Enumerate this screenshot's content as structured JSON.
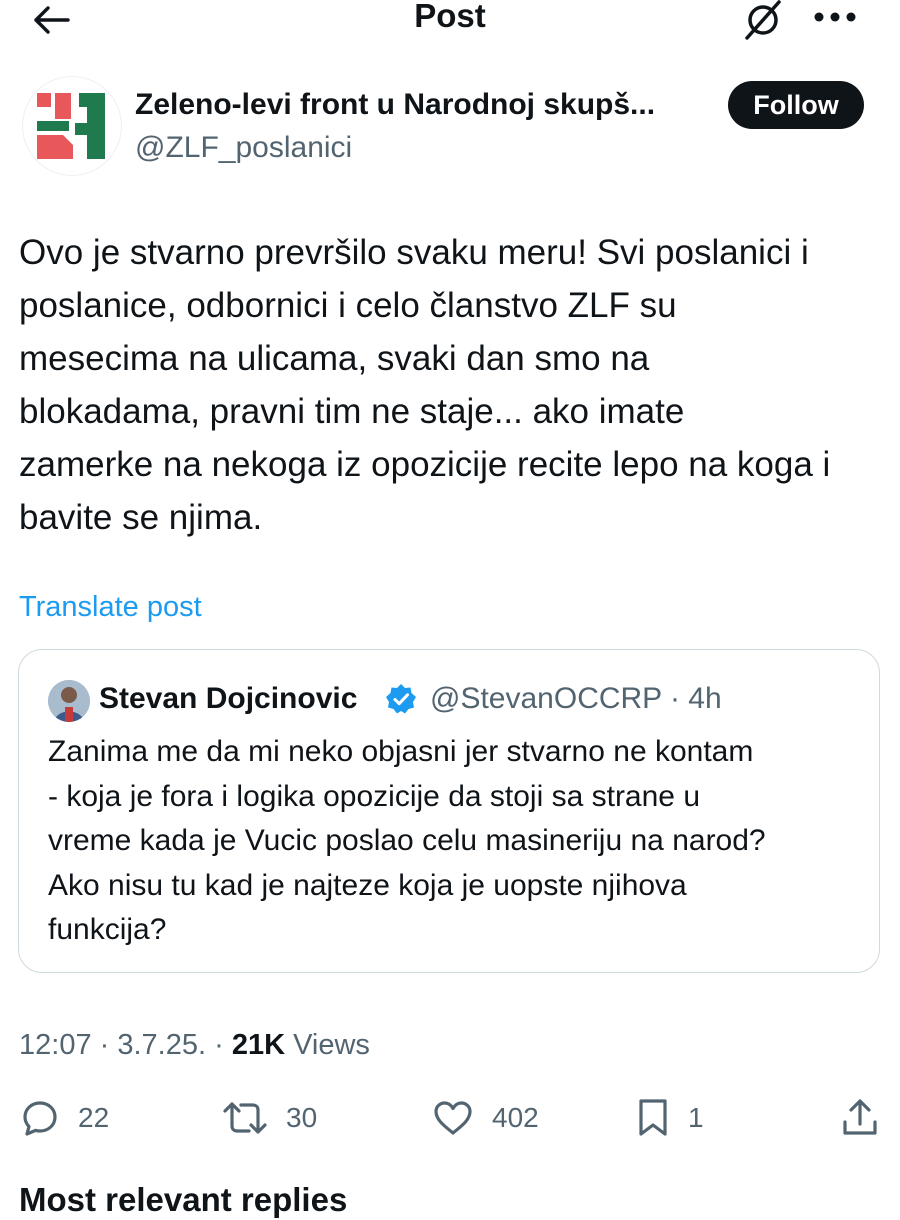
{
  "header": {
    "title": "Post"
  },
  "author": {
    "display_name": "Zeleno-levi front u Narodnoj skupš...",
    "handle": "@ZLF_poslanici",
    "follow_label": "Follow"
  },
  "post": {
    "text": "Ovo je stvarno prevršilo svaku meru! Svi poslanici i\nposlanice, odbornici i celo članstvo ZLF su\nmesecima na ulicama, svaki dan smo na\nblokadama, pravni tim ne staje... ako imate\nzamerke na nekoga iz opozicije recite lepo na koga i\nbavite se njima.",
    "translate_label": "Translate post"
  },
  "quote": {
    "name": "Stevan Dojcinovic",
    "handle_time": "@StevanOCCRP · 4h",
    "text": "Zanima me da mi neko objasni jer stvarno ne kontam\n- koja je fora i logika opozicije da stoji sa strane u\nvreme kada je Vucic poslao celu masineriju na narod?\nAko nisu tu kad je najteze koja je uopste njihova\nfunkcija?"
  },
  "meta": {
    "time_date": "12:07 · 3.7.25. · ",
    "views_count": "21K",
    "views_label": " Views"
  },
  "actions": {
    "replies": "22",
    "reposts": "30",
    "likes": "402",
    "bookmarks": "1"
  },
  "more_section_heading": "Most relevant replies",
  "colors": {
    "accent": "#1d9bf0",
    "text": "#0f1419",
    "muted": "#536471",
    "logo_red": "#e8585a",
    "logo_green": "#1f7a4d"
  }
}
